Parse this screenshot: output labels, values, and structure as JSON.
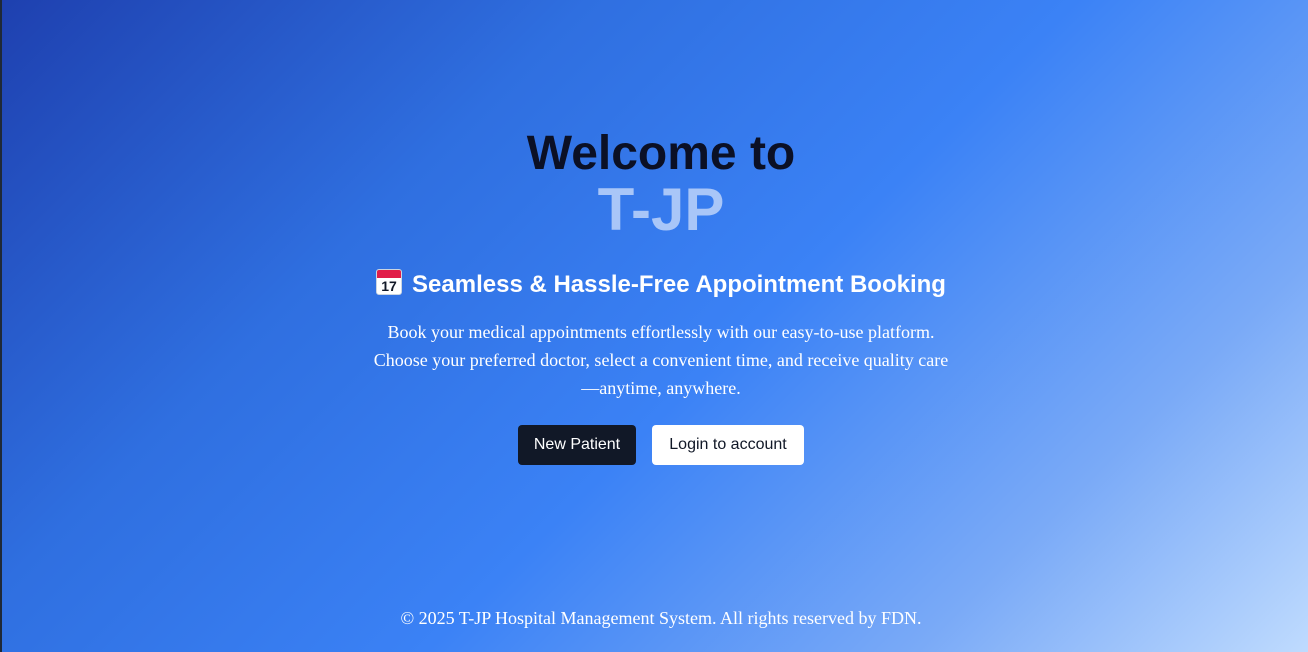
{
  "hero": {
    "welcome": "Welcome to",
    "brand": "T-JP",
    "tagline": "Seamless & Hassle-Free Appointment Booking",
    "calendar_icon": {
      "month": "July",
      "day": "17"
    },
    "description": "Book your medical appointments effortlessly with our easy-to-use platform. Choose your preferred doctor, select a convenient time, and receive quality care —anytime, anywhere."
  },
  "actions": {
    "new_patient_label": "New Patient",
    "login_label": "Login to account"
  },
  "footer": {
    "text": "© 2025 T-JP Hospital Management System. All rights reserved by FDN."
  },
  "colors": {
    "gradient_start": "#1e40af",
    "gradient_mid": "#3b82f6",
    "gradient_end": "#bfdbfe",
    "brand": "#a9c6f8",
    "heading": "#0b1025",
    "primary_button": "#111827"
  }
}
